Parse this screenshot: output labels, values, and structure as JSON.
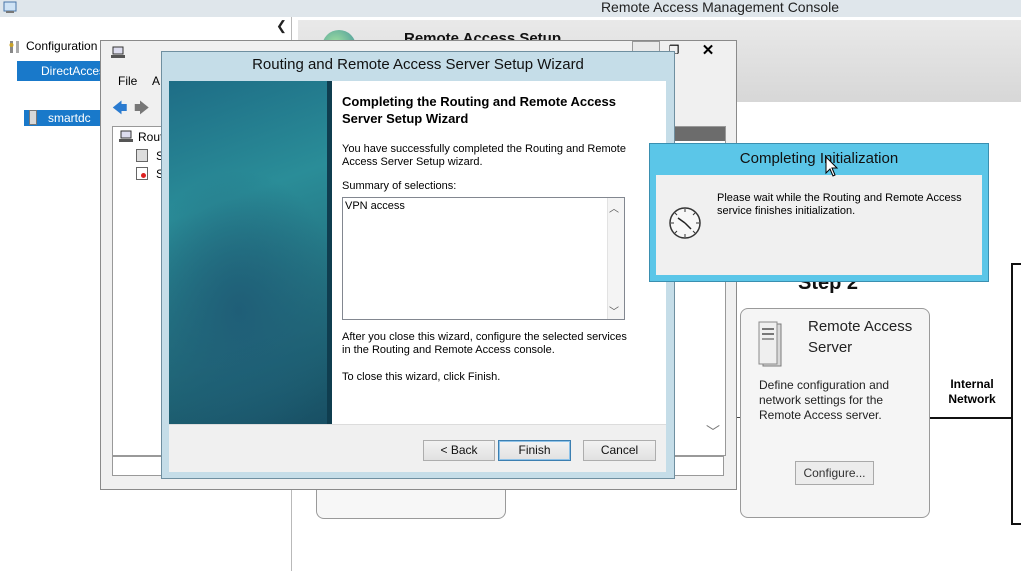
{
  "console": {
    "title": "Remote Access Management Console",
    "nav": {
      "configuration_label": "Configuration",
      "directaccess_label": "DirectAccess",
      "server_label": "smartdc"
    },
    "header_title": "Remote Access Setup",
    "step2": {
      "label": "Step 2",
      "card_title": "Remote Access Server",
      "card_description": "Define configuration and network settings for the Remote Access server.",
      "configure_button": "Configure...",
      "internal_network_label": "Internal Network"
    }
  },
  "rras_window": {
    "menu": {
      "file": "File",
      "action": "A"
    },
    "tree": {
      "root": "Rout",
      "item1": "S",
      "item2": "S"
    },
    "close_glyph": "✕",
    "maximize_glyph": "❐"
  },
  "wizard": {
    "title": "Routing and Remote Access Server Setup Wizard",
    "heading": "Completing the Routing and Remote Access Server Setup Wizard",
    "intro": "You have successfully completed the Routing and Remote Access Server Setup wizard.",
    "summary_label": "Summary of selections:",
    "summary_value": "VPN access",
    "after_text": "After you close this wizard, configure the selected services in the Routing and  Remote Access console.",
    "close_text": "To close this wizard, click Finish.",
    "buttons": {
      "back": "< Back",
      "finish": "Finish",
      "cancel": "Cancel"
    }
  },
  "init_dialog": {
    "title": "Completing Initialization",
    "message": "Please wait while the Routing and Remote Access service finishes initialization."
  },
  "colors": {
    "selection_blue": "#1979ca",
    "dialog_accent": "#5bc6e8",
    "wizard_frame": "#c5dde8",
    "banner_teal": "#2a8d98"
  },
  "icons": {
    "console_app": "mmc-icon",
    "back": "back-arrow-icon",
    "forward": "forward-arrow-icon",
    "server": "server-icon",
    "clock": "clock-icon",
    "globe": "globe-icon"
  }
}
